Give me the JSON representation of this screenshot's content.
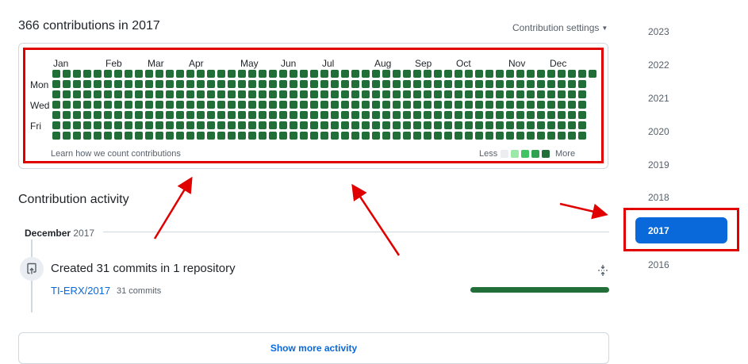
{
  "header": {
    "title": "366 contributions in 2017",
    "settings_label": "Contribution settings"
  },
  "calendar": {
    "months": [
      "Jan",
      "Feb",
      "Mar",
      "Apr",
      "May",
      "Jun",
      "Jul",
      "Aug",
      "Sep",
      "Oct",
      "Nov",
      "Dec"
    ],
    "days": [
      "Mon",
      "Wed",
      "Fri"
    ],
    "cell_color": "#216e39",
    "learn_link": "Learn how we count contributions",
    "legend_less": "Less",
    "legend_more": "More",
    "legend_colors": [
      "#ebedf0",
      "#9be9a8",
      "#40c463",
      "#30a14e",
      "#216e39"
    ]
  },
  "activity": {
    "title": "Contribution activity",
    "month": "December",
    "year": "2017",
    "summary": "Created 31 commits in 1 repository",
    "repo_name": "TI-ERX/2017",
    "repo_commits": "31 commits"
  },
  "show_more_label": "Show more activity",
  "years": {
    "items": [
      "2023",
      "2022",
      "2021",
      "2020",
      "2019",
      "2018"
    ],
    "selected": "2017",
    "after": "2016"
  },
  "colors": {
    "accent": "#0969da",
    "annotation": "#e00000"
  }
}
